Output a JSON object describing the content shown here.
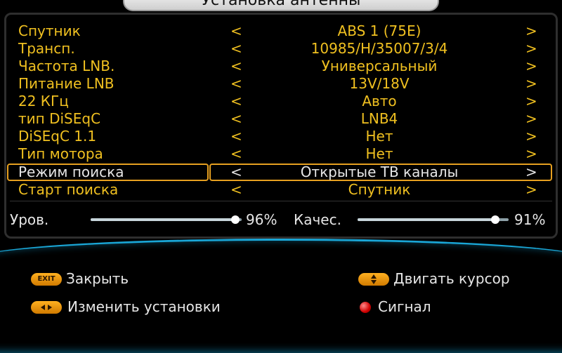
{
  "window": {
    "title": "Установка антенны"
  },
  "rows": [
    {
      "label": "Спутник",
      "value": "ABS 1  (75E)",
      "left_arrow": "<",
      "right_arrow": ">"
    },
    {
      "label": "Трансп.",
      "value": "10985/H/35007/3/4",
      "left_arrow": "<",
      "right_arrow": ">"
    },
    {
      "label": "Частота LNB.",
      "value": "Универсальный",
      "left_arrow": "<",
      "right_arrow": ">"
    },
    {
      "label": "Питание LNB",
      "value": "13V/18V",
      "left_arrow": "<",
      "right_arrow": ">"
    },
    {
      "label": "22 КГц",
      "value": "Авто",
      "left_arrow": "<",
      "right_arrow": ">"
    },
    {
      "label": "тип DiSEqC",
      "value": "LNB4",
      "left_arrow": "<",
      "right_arrow": ">"
    },
    {
      "label": "DiSEqC 1.1",
      "value": "Нет",
      "left_arrow": "<",
      "right_arrow": ">"
    },
    {
      "label": "Тип мотора",
      "value": "Нет",
      "left_arrow": "<",
      "right_arrow": ">"
    },
    {
      "label": "Режим поиска",
      "value": "Открытые ТВ каналы",
      "left_arrow": "<",
      "right_arrow": ">",
      "selected": true
    },
    {
      "label": "Старт поиска",
      "value": "Спутник",
      "left_arrow": "<",
      "right_arrow": ">"
    }
  ],
  "signal": {
    "level_label": "Уров.",
    "level_value": "96%",
    "level_fraction": 0.96,
    "quality_label": "Качес.",
    "quality_value": "91%",
    "quality_fraction": 0.91
  },
  "hints": {
    "exit_button": "EXIT",
    "close": "Закрыть",
    "move_cursor": "Двигать курсор",
    "change_settings": "Изменить установки",
    "signal": "Сигнал"
  },
  "colors": {
    "label_text": "#f0c020",
    "selected_text": "#e6e6e6",
    "selection_border": "#e6a020",
    "footer_accent": "#1aa6d6",
    "button_orange": "#ffb020",
    "button_red": "#d10000"
  }
}
